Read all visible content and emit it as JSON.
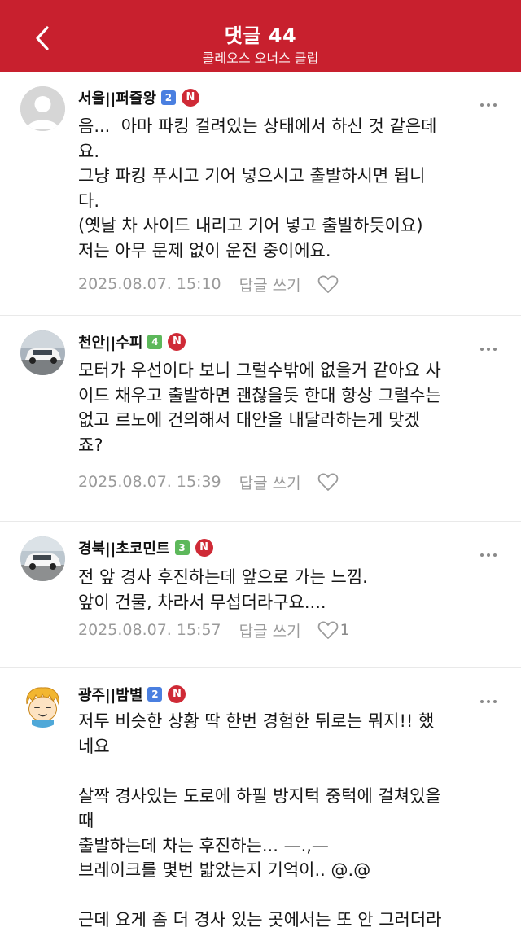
{
  "header": {
    "title": "댓글 44",
    "subtitle": "콜레오스 오너스 클럽",
    "back_icon": "chevron-left-icon",
    "background": "#c8202e"
  },
  "comments": [
    {
      "author": "서울||퍼즐왕",
      "grade": "2",
      "grade_color": "#4a7fe0",
      "badge": "N",
      "body": "음...  아마 파킹 걸려있는 상태에서 하신 것 같은데\n요.\n그냥 파킹 푸시고 기어 넣으시고 출발하시면 됩니\n다.\n(옛날 차 사이드 내리고 기어 넣고 출발하듯이요)\n저는 아무 문제 없이 운전 중이에요.",
      "date": "2025.08.07. 15:10",
      "reply": "답글 쓰기",
      "likes": ""
    },
    {
      "author": "천안||수피",
      "grade": "4",
      "grade_color": "#5db85b",
      "badge": "N",
      "body": "모터가 우선이다 보니 그럴수밖에 없을거 같아요 사\n이드 채우고 출발하면 괜찮을듯 한대 항상 그럴수는\n없고 르노에 건의해서 대안을 내달라하는게 맞겠\n죠?",
      "date": "2025.08.07. 15:39",
      "reply": "답글 쓰기",
      "likes": ""
    },
    {
      "author": "경북||초코민트",
      "grade": "3",
      "grade_color": "#5db85b",
      "badge": "N",
      "body": "전 앞 경사 후진하는데 앞으로 가는 느낌.\n앞이 건물, 차라서 무섭더라구요....",
      "date": "2025.08.07. 15:57",
      "reply": "답글 쓰기",
      "likes": "1"
    },
    {
      "author": "광주||밤별",
      "grade": "2",
      "grade_color": "#4a7fe0",
      "badge": "N",
      "body": "저두 비슷한 상황 딱 한번 경험한 뒤로는 뭐지!! 했\n네요\n\n살짝 경사있는 도로에 하필 방지턱 중턱에 걸쳐있을\n때\n출발하는데 차는 후진하는... —.,—\n브레이크를 몇번 밟았는지 기억이.. @.@\n\n근데 요게 좀 더 경사 있는 곳에서는 또 안 그러더라",
      "date": "",
      "reply": "",
      "likes": ""
    }
  ],
  "icons": {
    "more": "more-horizontal-icon",
    "like": "heart-outline-icon"
  }
}
